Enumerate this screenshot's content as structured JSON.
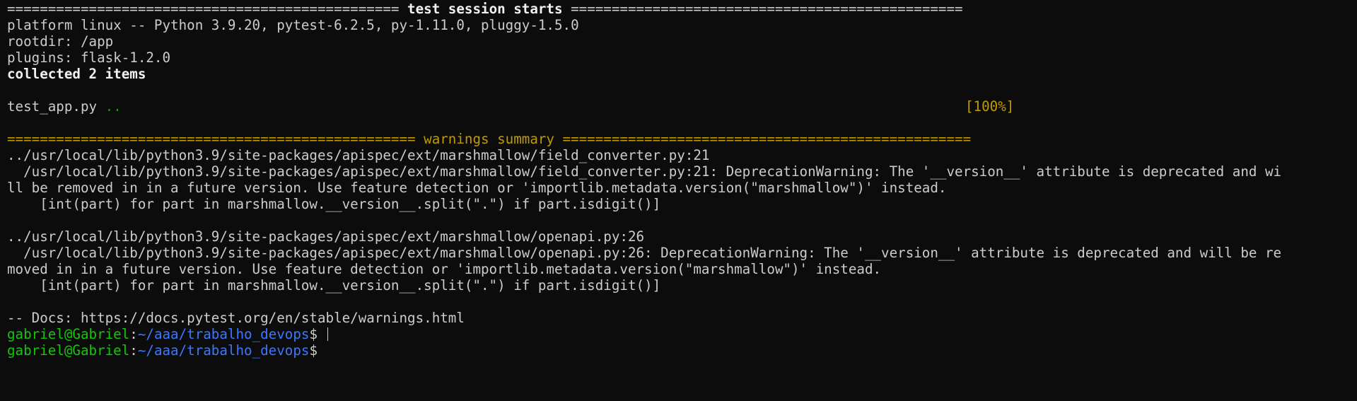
{
  "terminal": {
    "header_left": "================================================ ",
    "header_title": "test session starts",
    "header_right": " ================================================",
    "platform": "platform linux -- Python 3.9.20, pytest-6.2.5, py-1.11.0, pluggy-1.5.0",
    "rootdir": "rootdir: /app",
    "plugins": "plugins: flask-1.2.0",
    "collected": "collected 2 items",
    "test_file": "test_app.py ",
    "test_dots": "..",
    "test_percent": "[100%]",
    "warnings_header": "================================================== warnings summary ==================================================",
    "w1_location": "../usr/local/lib/python3.9/site-packages/apispec/ext/marshmallow/field_converter.py:21",
    "w1_msg_line1": "  /usr/local/lib/python3.9/site-packages/apispec/ext/marshmallow/field_converter.py:21: DeprecationWarning: The '__version__' attribute is deprecated and wi",
    "w1_msg_line2": "ll be removed in in a future version. Use feature detection or 'importlib.metadata.version(\"marshmallow\")' instead.",
    "w1_code": "    [int(part) for part in marshmallow.__version__.split(\".\") if part.isdigit()]",
    "w2_location": "../usr/local/lib/python3.9/site-packages/apispec/ext/marshmallow/openapi.py:26",
    "w2_msg_line1": "  /usr/local/lib/python3.9/site-packages/apispec/ext/marshmallow/openapi.py:26: DeprecationWarning: The '__version__' attribute is deprecated and will be re",
    "w2_msg_line2": "moved in in a future version. Use feature detection or 'importlib.metadata.version(\"marshmallow\")' instead.",
    "w2_code": "    [int(part) for part in marshmallow.__version__.split(\".\") if part.isdigit()]",
    "docs": "-- Docs: https://docs.pytest.org/en/stable/warnings.html",
    "prompt_user": "gabriel@Gabriel",
    "prompt_sep": ":",
    "prompt_path": "~/aaa/trabalho_devops",
    "prompt_symbol": "$ "
  },
  "colors": {
    "background": "#0c0c0c",
    "foreground": "#cccccc",
    "green": "#13a10e",
    "yellow": "#c19c00",
    "prompt_user": "#16c60c",
    "prompt_path": "#3b78ff"
  }
}
